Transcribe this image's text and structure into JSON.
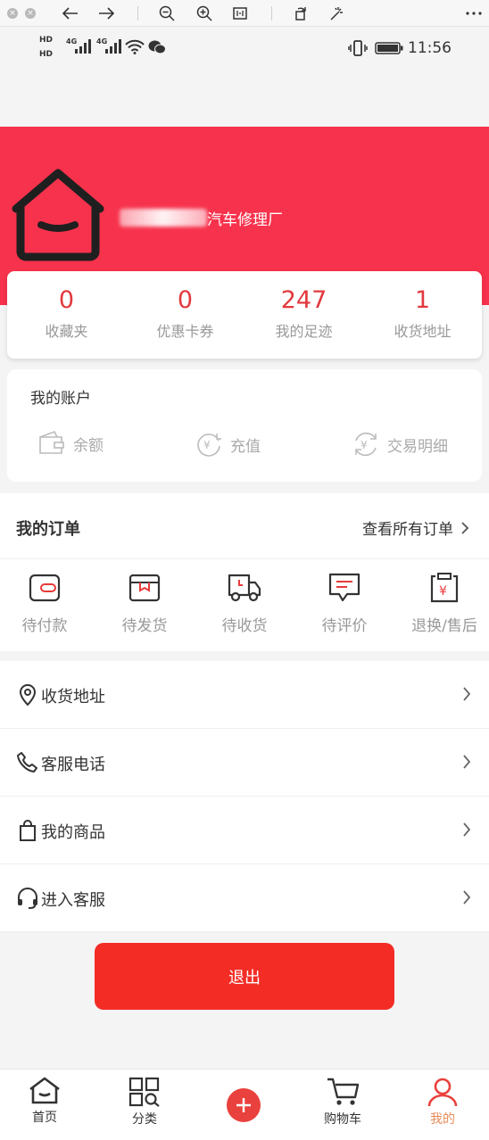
{
  "toolbar": {
    "buttons": [
      "close-icon",
      "close-icon",
      "back-arrow-icon",
      "forward-arrow-icon",
      "zoom-out-icon",
      "zoom-in-icon",
      "fit-page-icon",
      "rotate-icon",
      "magic-wand-icon",
      "more-icon"
    ]
  },
  "status_bar": {
    "time": "11:56",
    "hd1": "HD",
    "hd2": "HD",
    "net1": "4G",
    "net2": "4G"
  },
  "profile": {
    "shop_name": "汽车修理厂"
  },
  "stats": [
    {
      "value": "0",
      "label": "收藏夹"
    },
    {
      "value": "0",
      "label": "优惠卡券"
    },
    {
      "value": "247",
      "label": "我的足迹"
    },
    {
      "value": "1",
      "label": "收货地址"
    }
  ],
  "account": {
    "title": "我的账户",
    "items": [
      {
        "label": "余额",
        "icon": "wallet-icon"
      },
      {
        "label": "充值",
        "icon": "recharge-icon"
      },
      {
        "label": "交易明细",
        "icon": "transaction-icon"
      }
    ]
  },
  "orders": {
    "title": "我的订单",
    "view_all": "查看所有订单",
    "items": [
      {
        "label": "待付款",
        "icon": "wallet-icon"
      },
      {
        "label": "待发货",
        "icon": "package-icon"
      },
      {
        "label": "待收货",
        "icon": "truck-icon"
      },
      {
        "label": "待评价",
        "icon": "comment-icon"
      },
      {
        "label": "退换/售后",
        "icon": "refund-icon"
      }
    ]
  },
  "menu": [
    {
      "label": "收货地址",
      "icon": "location-pin-icon"
    },
    {
      "label": "客服电话",
      "icon": "phone-icon"
    },
    {
      "label": "我的商品",
      "icon": "shopping-bag-icon"
    },
    {
      "label": "进入客服",
      "icon": "headset-icon"
    }
  ],
  "logout_label": "退出",
  "tabbar": [
    {
      "label": "首页",
      "icon": "home-icon",
      "active": false
    },
    {
      "label": "分类",
      "icon": "category-icon",
      "active": false
    },
    {
      "label": "",
      "icon": "plus-icon",
      "active": false
    },
    {
      "label": "购物车",
      "icon": "cart-icon",
      "active": false
    },
    {
      "label": "我的",
      "icon": "user-icon",
      "active": true
    }
  ],
  "colors": {
    "banner": "#f7324c",
    "accent": "#e2393e",
    "logout": "#f32d26",
    "active_tab": "#e88b5a"
  }
}
